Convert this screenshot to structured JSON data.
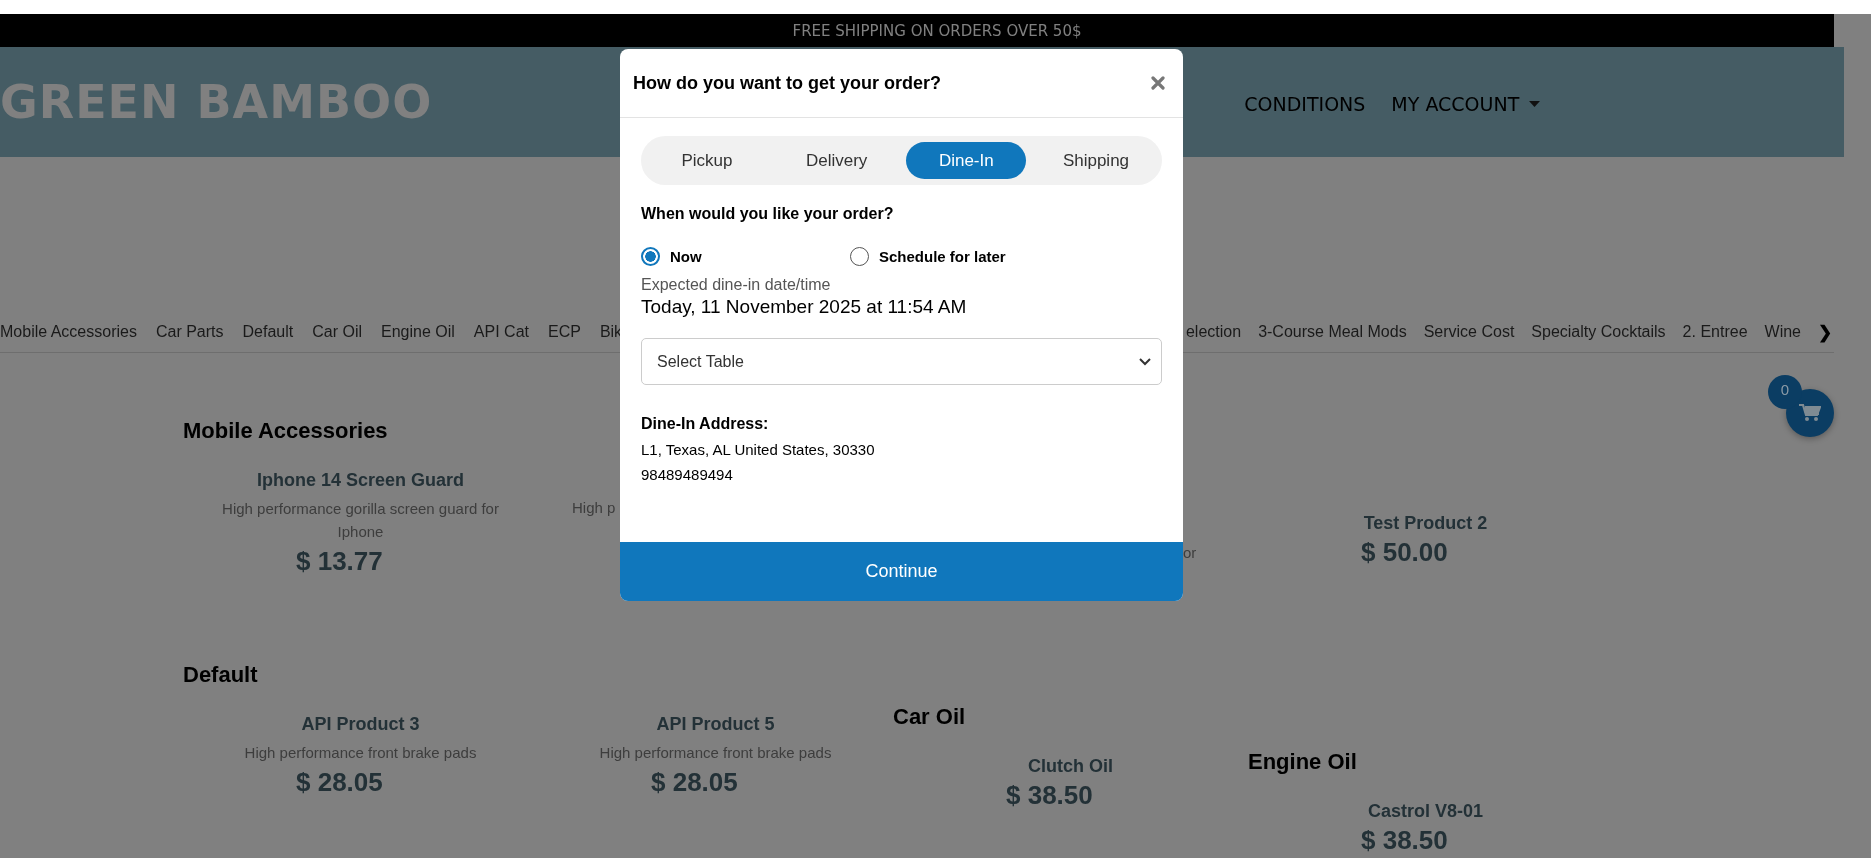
{
  "banner": {
    "text": "FREE SHIPPING ON ORDERS OVER 50$"
  },
  "header": {
    "logo": "GREEN BAMBOO",
    "nav": [
      {
        "label": "CONDITIONS",
        "dropdown": false
      },
      {
        "label": "MY ACCOUNT",
        "dropdown": true
      }
    ]
  },
  "categories": {
    "left": [
      "Mobile Accessories",
      "Car Parts",
      "Default",
      "Car Oil",
      "Engine Oil",
      "API Cat",
      "ECP",
      "Bik"
    ],
    "right": [
      "election",
      "3-Course Meal Mods",
      "Service Cost",
      "Specialty Cocktails",
      "2. Entree",
      "Wine"
    ],
    "next": "❯"
  },
  "cart": {
    "count": "0"
  },
  "sections": [
    {
      "title": "Mobile Accessories",
      "products": [
        {
          "title": "Iphone 14 Screen Guard",
          "description": "High performance gorilla screen guard for Iphone",
          "price": "$ 13.77"
        },
        {
          "description": "High p"
        },
        {
          "description": "or"
        },
        {
          "title": "Test Product 2",
          "price": "$ 50.00"
        }
      ]
    },
    {
      "title": "Default",
      "products": [
        {
          "title": "API Product 3",
          "description": "High performance front brake pads",
          "price": "$ 28.05"
        },
        {
          "title": "API Product 5",
          "description": "High performance front brake pads",
          "price": "$ 28.05"
        }
      ]
    },
    {
      "title": "Car Oil",
      "products": [
        {
          "title": "Clutch Oil",
          "price": "$ 38.50"
        }
      ]
    },
    {
      "title": "Engine Oil",
      "products": [
        {
          "title": "Castrol V8-01",
          "price": "$ 38.50"
        }
      ]
    }
  ],
  "modal": {
    "title": "How do you want to get your order?",
    "tabs": [
      {
        "label": "Pickup",
        "selected": false
      },
      {
        "label": "Delivery",
        "selected": false
      },
      {
        "label": "Dine-In",
        "selected": true
      },
      {
        "label": "Shipping",
        "selected": false
      }
    ],
    "question": "When would you like your order?",
    "options": [
      {
        "label": "Now",
        "selected": true
      },
      {
        "label": "Schedule for later",
        "selected": false
      }
    ],
    "expected_label": "Expected dine-in date/time",
    "expected_value": "Today, 11 November 2025 at 11:54 AM",
    "table_select": {
      "placeholder": "Select Table"
    },
    "address_label": "Dine-In Address:",
    "address": "L1, Texas, AL United States, 30330",
    "phone": "98489489494",
    "continue": "Continue"
  }
}
